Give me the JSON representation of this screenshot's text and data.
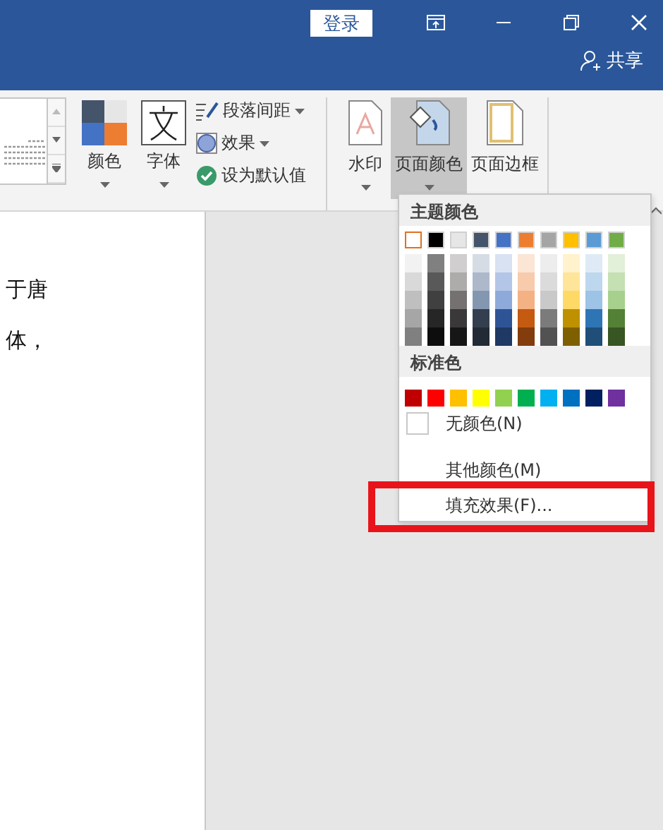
{
  "title_bar": {
    "sign_in": "登录",
    "share": "共享"
  },
  "ribbon": {
    "theme_colors": "颜色",
    "fonts": "字体",
    "paragraph_spacing": "段落间距",
    "effects": "效果",
    "set_default": "设为默认值",
    "watermark": "水印",
    "page_color": {
      "label": "页面颜色",
      "selected": true
    },
    "page_borders": "页面边框"
  },
  "document": {
    "lines": [
      "于唐",
      "体，"
    ]
  },
  "page_color_menu": {
    "theme_header": "主题颜色",
    "theme_colors": [
      {
        "color": "#ffffff",
        "selected": true,
        "shades": [
          {
            "color": "#f2f2f2"
          },
          {
            "color": "#d9d9d9"
          },
          {
            "color": "#bfbfbf"
          },
          {
            "color": "#a6a6a6"
          },
          {
            "color": "#808080"
          }
        ]
      },
      {
        "color": "#000000",
        "selected": false,
        "shades": [
          {
            "color": "#808080"
          },
          {
            "color": "#595959"
          },
          {
            "color": "#404040"
          },
          {
            "color": "#262626"
          },
          {
            "color": "#0d0d0d"
          }
        ]
      },
      {
        "color": "#e7e6e6",
        "selected": false,
        "shades": [
          {
            "color": "#d0cece"
          },
          {
            "color": "#aeabab"
          },
          {
            "color": "#757171"
          },
          {
            "color": "#3a3838"
          },
          {
            "color": "#171616"
          }
        ]
      },
      {
        "color": "#44546a",
        "selected": false,
        "shades": [
          {
            "color": "#d6dce4"
          },
          {
            "color": "#adb9ca"
          },
          {
            "color": "#8497b0"
          },
          {
            "color": "#333f4f"
          },
          {
            "color": "#222a35"
          }
        ]
      },
      {
        "color": "#4472c4",
        "selected": false,
        "shades": [
          {
            "color": "#d9e2f3"
          },
          {
            "color": "#b4c6e7"
          },
          {
            "color": "#8eaadb"
          },
          {
            "color": "#2f5496"
          },
          {
            "color": "#1f3864"
          }
        ]
      },
      {
        "color": "#ed7d31",
        "selected": false,
        "shades": [
          {
            "color": "#fbe5d5"
          },
          {
            "color": "#f7cbac"
          },
          {
            "color": "#f4b183"
          },
          {
            "color": "#c55a11"
          },
          {
            "color": "#833c0b"
          }
        ]
      },
      {
        "color": "#a5a5a5",
        "selected": false,
        "shades": [
          {
            "color": "#ededed"
          },
          {
            "color": "#dbdbdb"
          },
          {
            "color": "#c9c9c9"
          },
          {
            "color": "#7b7b7b"
          },
          {
            "color": "#525252"
          }
        ]
      },
      {
        "color": "#ffc000",
        "selected": false,
        "shades": [
          {
            "color": "#fff2cc"
          },
          {
            "color": "#ffe599"
          },
          {
            "color": "#ffd966"
          },
          {
            "color": "#bf9000"
          },
          {
            "color": "#7f6000"
          }
        ]
      },
      {
        "color": "#5b9bd5",
        "selected": false,
        "shades": [
          {
            "color": "#deebf6"
          },
          {
            "color": "#bdd7ee"
          },
          {
            "color": "#9dc3e6"
          },
          {
            "color": "#2e75b5"
          },
          {
            "color": "#1f4e79"
          }
        ]
      },
      {
        "color": "#70ad47",
        "selected": false,
        "shades": [
          {
            "color": "#e2efd9"
          },
          {
            "color": "#c5e0b3"
          },
          {
            "color": "#a8d08d"
          },
          {
            "color": "#538135"
          },
          {
            "color": "#375623"
          }
        ]
      }
    ],
    "standard_header": "标准色",
    "standard_colors": [
      {
        "color": "#c00000"
      },
      {
        "color": "#ff0000"
      },
      {
        "color": "#ffc000"
      },
      {
        "color": "#ffff00"
      },
      {
        "color": "#92d050"
      },
      {
        "color": "#00b050"
      },
      {
        "color": "#00b0f0"
      },
      {
        "color": "#0070c0"
      },
      {
        "color": "#002060"
      },
      {
        "color": "#7030a0"
      }
    ],
    "items": [
      {
        "kind": "no-color",
        "label": "无颜色(N)",
        "highlighted": false
      },
      {
        "kind": "more",
        "label": "其他颜色(M)",
        "highlighted": false
      },
      {
        "kind": "fill",
        "label": "填充效果(F)...",
        "highlighted": true
      }
    ]
  }
}
